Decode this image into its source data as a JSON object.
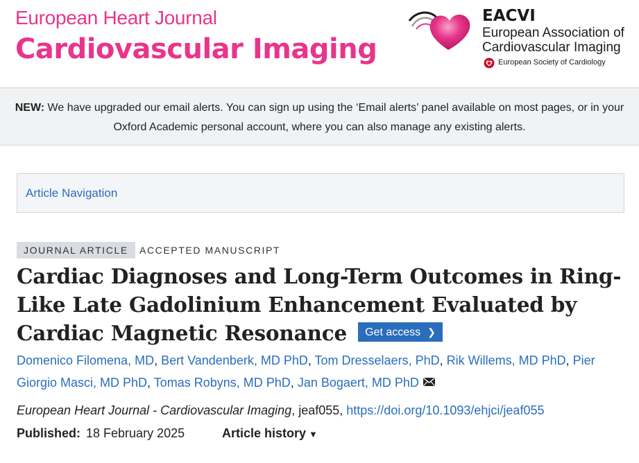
{
  "header": {
    "journal_line1": "European Heart Journal",
    "journal_line2": "Cardiovascular Imaging",
    "society_abbr": "EACVI",
    "society_name_line1": "European Association of",
    "society_name_line2": "Cardiovascular Imaging",
    "parent_society": "European Society of Cardiology"
  },
  "banner": {
    "lead": "NEW:",
    "text": " We have upgraded our email alerts. You can sign up using the ‘Email alerts’ panel available on most pages, or in your Oxford Academic personal account, where you can also manage any existing alerts."
  },
  "article_nav": {
    "label": "Article Navigation"
  },
  "article": {
    "type_label": "JOURNAL ARTICLE",
    "status_label": "ACCEPTED MANUSCRIPT",
    "title": "Cardiac Diagnoses and Long-Term Outcomes in Ring-Like Late Gadolinium Enhancement Evaluated by Cardiac Magnetic Resonance",
    "get_access_label": "Get access",
    "authors": [
      "Domenico Filomena, MD",
      "Bert Vandenberk, MD PhD",
      "Tom Dresselaers, PhD",
      "Rik Willems, MD PhD",
      "Pier Giorgio Masci, MD PhD",
      "Tomas Robyns, MD PhD",
      "Jan Bogaert, MD PhD"
    ],
    "citation": {
      "journal": "European Heart Journal - Cardiovascular Imaging",
      "article_id": ", jeaf055, ",
      "doi": "https://doi.org/10.1093/ehjci/jeaf055"
    },
    "published_label": "Published:",
    "published_date": "18 February 2025",
    "history_label": "Article history"
  },
  "colors": {
    "brand_pink": "#e8358b",
    "link_blue": "#2a6ebb",
    "banner_bg": "#f1f2f4"
  },
  "icons": [
    "eacvi-heart-logo",
    "esc-heart-icon",
    "chevron-right-icon",
    "mail-icon",
    "caret-down-icon"
  ]
}
